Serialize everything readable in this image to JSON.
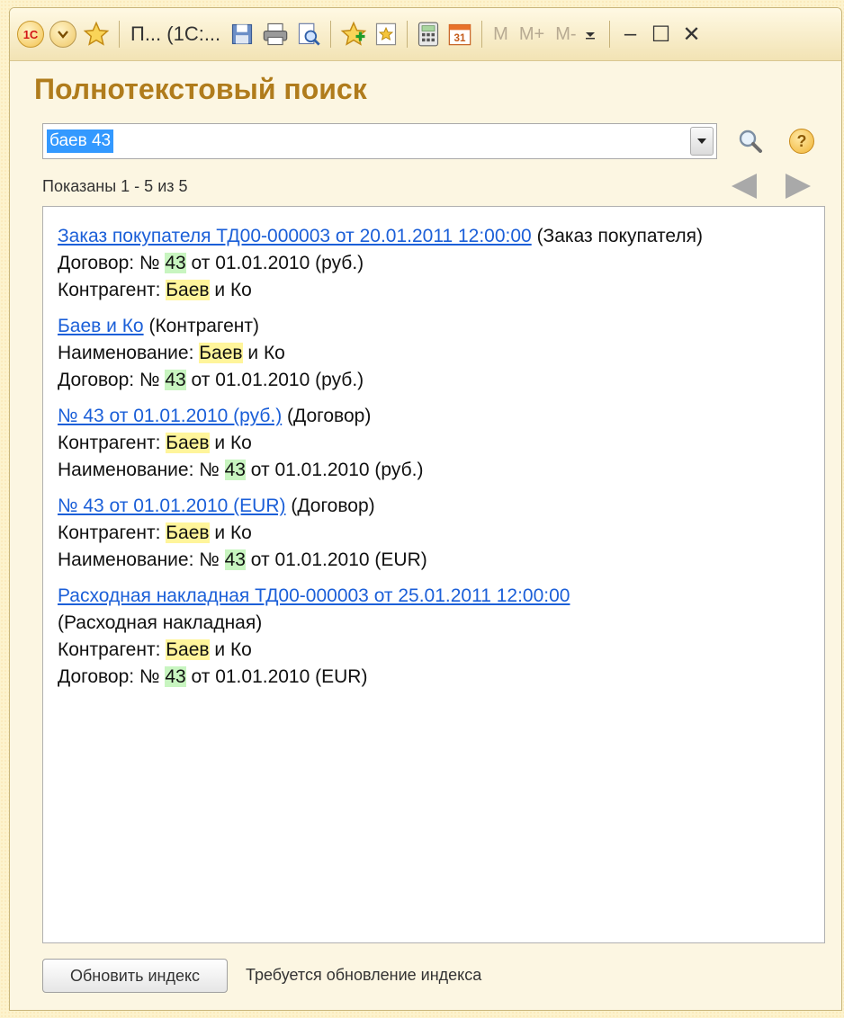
{
  "window": {
    "title": "П... (1С:...",
    "mem_buttons": [
      "M",
      "M+",
      "M-"
    ],
    "controls": {
      "minimize": "–",
      "maximize": "☐",
      "close": "✕"
    },
    "logo": "1С"
  },
  "heading": "Полнотекстовый поиск",
  "search": {
    "query": "баев 43"
  },
  "shown": "Показаны 1 - 5 из 5",
  "help_symbol": "?",
  "results": [
    {
      "link": "Заказ покупателя ТД00-000003 от 20.01.2011 12:00:00",
      "type": "(Заказ покупателя)",
      "lines": [
        {
          "label": "Договор: № ",
          "highlight": "43",
          "hl": "green",
          "rest": " от 01.01.2010 (руб.)"
        },
        {
          "label": "Контрагент: ",
          "highlight": "Баев",
          "hl": "yellow",
          "rest": " и Ко"
        }
      ]
    },
    {
      "link": "Баев и Ко",
      "type": "(Контрагент)",
      "lines": [
        {
          "label": "Наименование: ",
          "highlight": "Баев",
          "hl": "yellow",
          "rest": " и Ко"
        },
        {
          "label": "Договор: № ",
          "highlight": "43",
          "hl": "green",
          "rest": " от 01.01.2010 (руб.)"
        }
      ]
    },
    {
      "link": "№ 43 от 01.01.2010 (руб.)",
      "type": "(Договор)",
      "lines": [
        {
          "label": "Контрагент: ",
          "highlight": "Баев",
          "hl": "yellow",
          "rest": " и Ко"
        },
        {
          "label": "Наименование: № ",
          "highlight": "43",
          "hl": "green",
          "rest": " от 01.01.2010 (руб.)"
        }
      ]
    },
    {
      "link": "№ 43 от 01.01.2010 (EUR)",
      "type": "(Договор)",
      "lines": [
        {
          "label": "Контрагент: ",
          "highlight": "Баев",
          "hl": "yellow",
          "rest": " и Ко"
        },
        {
          "label": "Наименование: № ",
          "highlight": "43",
          "hl": "green",
          "rest": " от 01.01.2010 (EUR)"
        }
      ]
    },
    {
      "link": "Расходная накладная ТД00-000003 от 25.01.2011 12:00:00",
      "type": "(Расходная накладная)",
      "lines": [
        {
          "label": "Контрагент: ",
          "highlight": "Баев",
          "hl": "yellow",
          "rest": " и Ко"
        },
        {
          "label": "Договор: № ",
          "highlight": "43",
          "hl": "green",
          "rest": " от 01.01.2010 (EUR)"
        }
      ]
    }
  ],
  "footer": {
    "update_button": "Обновить индекс",
    "status": "Требуется обновление индекса"
  },
  "colors": {
    "heading": "#b07c1c",
    "link": "#1b5fd8",
    "highlight_yellow": "#fff59b",
    "highlight_green": "#c8f5c0",
    "selection": "#3399ff"
  }
}
